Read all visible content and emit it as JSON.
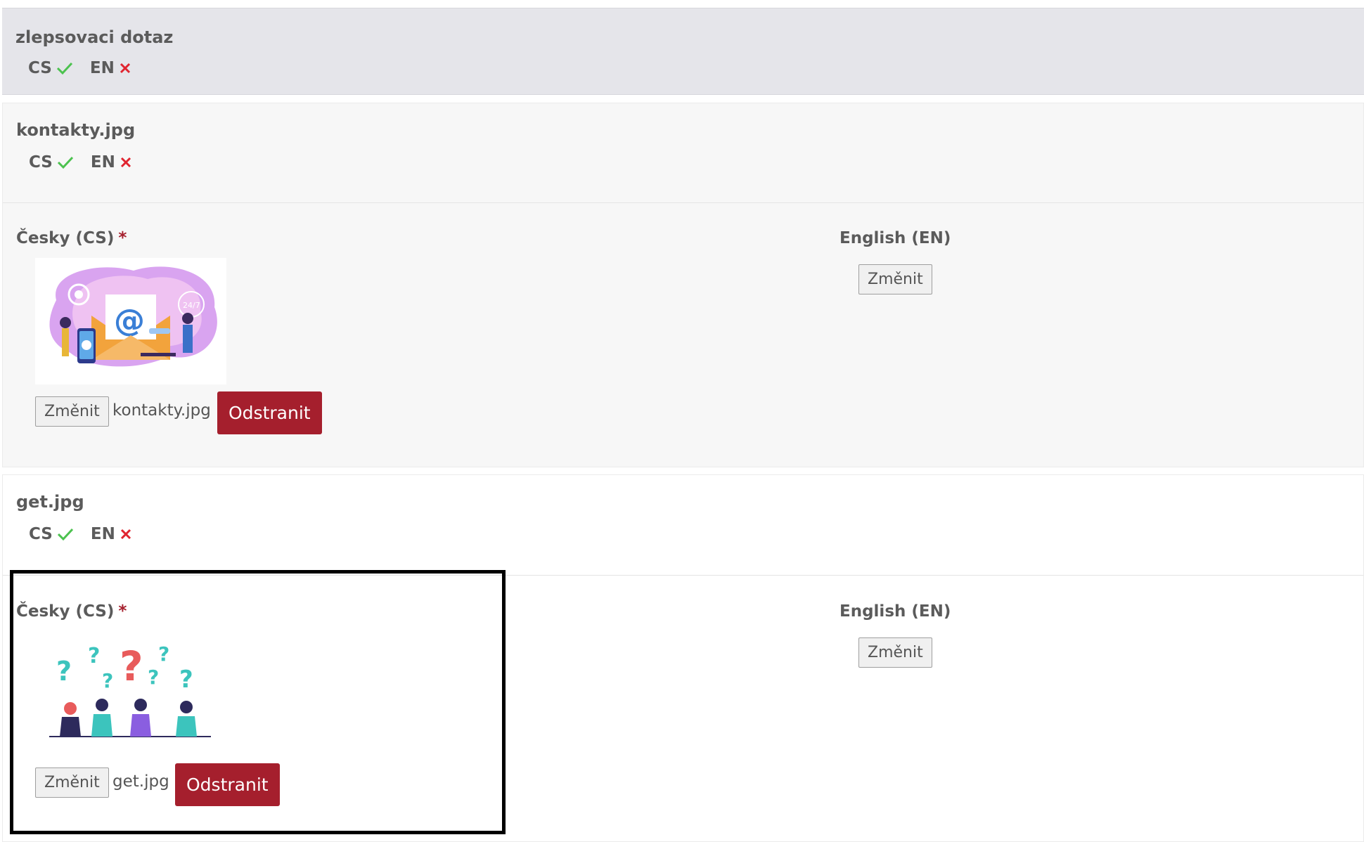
{
  "sections": [
    {
      "title": "zlepsovaci dotaz",
      "languages": [
        {
          "code": "CS",
          "status": "done"
        },
        {
          "code": "EN",
          "status": "missing"
        }
      ]
    },
    {
      "title": "kontakty.jpg",
      "languages": [
        {
          "code": "CS",
          "status": "done"
        },
        {
          "code": "EN",
          "status": "missing"
        }
      ],
      "cs_field": {
        "label": "Česky (CS)",
        "required_mark": "*",
        "change_label": "Změnit",
        "file_name": "kontakty.jpg",
        "remove_label": "Odstranit",
        "image": "contact-email-illustration"
      },
      "en_field": {
        "label": "English (EN)",
        "change_label": "Změnit"
      }
    },
    {
      "title": "get.jpg",
      "languages": [
        {
          "code": "CS",
          "status": "done"
        },
        {
          "code": "EN",
          "status": "missing"
        }
      ],
      "cs_field": {
        "label": "Česky (CS)",
        "required_mark": "*",
        "change_label": "Změnit",
        "file_name": "get.jpg",
        "remove_label": "Odstranit",
        "image": "people-question-marks-illustration"
      },
      "en_field": {
        "label": "English (EN)",
        "change_label": "Změnit"
      }
    }
  ],
  "colors": {
    "check": "#4cc24f",
    "cross": "#e0242f",
    "required": "#a51f2d",
    "remove_button": "#a51f2d",
    "top_panel_bg": "#e5e5ea",
    "panel_bg": "#f7f7f7"
  },
  "icons": {
    "done": "check-icon",
    "missing": "cross-icon"
  }
}
